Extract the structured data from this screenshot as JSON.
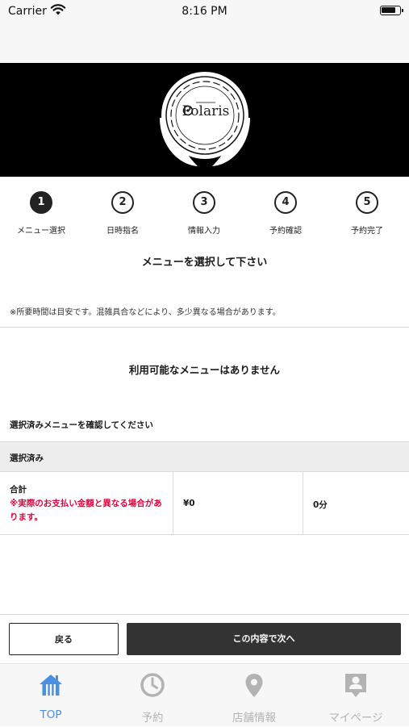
{
  "status_bar": {
    "carrier": "Carrier",
    "time": "8:16 PM"
  },
  "brand": {
    "logo_text": "Polaris"
  },
  "steps": [
    {
      "number": "1",
      "label": "メニュー選択",
      "active": true
    },
    {
      "number": "2",
      "label": "日時指名",
      "active": false
    },
    {
      "number": "3",
      "label": "情報入力",
      "active": false
    },
    {
      "number": "4",
      "label": "予約確認",
      "active": false
    },
    {
      "number": "5",
      "label": "予約完了",
      "active": false
    }
  ],
  "page_title": "メニューを選択して下さい",
  "note": "※所要時間は目安です。混雑具合などにより、多少異なる場合があります。",
  "no_menu_message": "利用可能なメニューはありません",
  "confirm_label": "選択済みメニューを確認してください",
  "selected": {
    "header": "選択済み",
    "total_label": "合計",
    "total_warning": "※実際のお支払い金額と異なる場合があります。",
    "price": "¥0",
    "duration": "0分"
  },
  "buttons": {
    "back": "戻る",
    "next": "この内容で次へ"
  },
  "tabs": [
    {
      "label": "TOP",
      "icon": "home-icon",
      "active": true
    },
    {
      "label": "予約",
      "icon": "clock-icon",
      "active": false
    },
    {
      "label": "店舗情報",
      "icon": "location-pin-icon",
      "active": false
    },
    {
      "label": "マイページ",
      "icon": "profile-card-icon",
      "active": false
    }
  ],
  "colors": {
    "accent": "#4a8fe0",
    "warning": "#e6003e",
    "dark_button": "#333333",
    "banner": "#000000"
  }
}
